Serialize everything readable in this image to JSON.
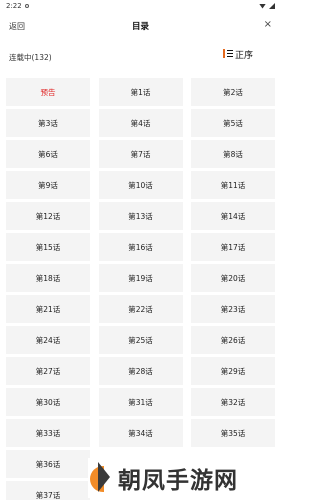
{
  "status_bar": {
    "time": "2:22"
  },
  "header": {
    "back_label": "返回",
    "title": "目录",
    "close_label": "×"
  },
  "subheader": {
    "status_text": "连载中(132)",
    "order_label": "正序"
  },
  "chapters": [
    "预告",
    "第1话",
    "第2话",
    "第3话",
    "第4话",
    "第5话",
    "第6话",
    "第7话",
    "第8话",
    "第9话",
    "第10话",
    "第11话",
    "第12话",
    "第13话",
    "第14话",
    "第15话",
    "第16话",
    "第17话",
    "第18话",
    "第19话",
    "第20话",
    "第21话",
    "第22话",
    "第23话",
    "第24话",
    "第25话",
    "第26话",
    "第27话",
    "第28话",
    "第29话",
    "第30话",
    "第31话",
    "第32话",
    "第33话",
    "第34话",
    "第35话",
    "第36话",
    "第37话"
  ],
  "watermark": {
    "text": "朝凤手游网"
  },
  "colors": {
    "preview_text": "#e02020",
    "accent_orange": "#e66a1e",
    "cell_bg": "#f4f4f4"
  }
}
